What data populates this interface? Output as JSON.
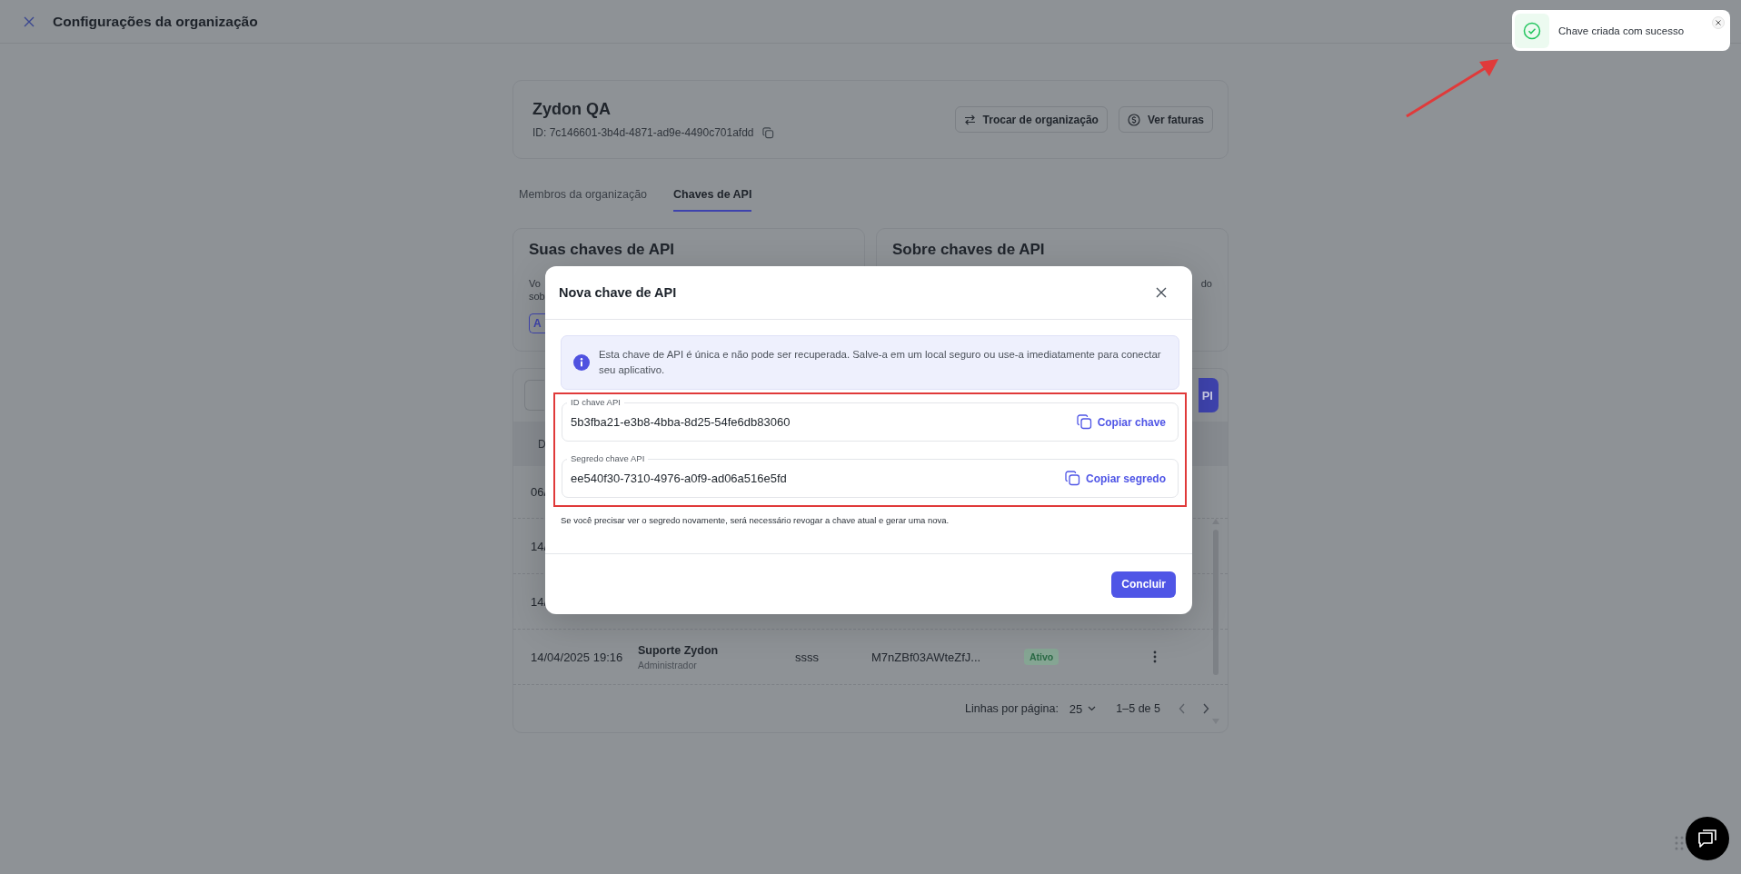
{
  "header": {
    "title": "Configurações da organização"
  },
  "organization": {
    "name": "Zydon QA",
    "id": "ID: 7c146601-3b4d-4871-ad9e-4490c701afdd",
    "actions": [
      {
        "label": "Trocar de organização",
        "kind": "switch"
      },
      {
        "label": "Ver faturas",
        "kind": "invoice"
      }
    ]
  },
  "tabs": [
    {
      "label": "Membros da organização",
      "selected": false
    },
    {
      "label": "Chaves de API",
      "selected": true
    }
  ],
  "cards": [
    {
      "title": "Suas chaves de API",
      "text_lines": [
        "Vo",
        "sob"
      ],
      "button": "A"
    },
    {
      "title": "Sobre chaves de API",
      "text_lines": [
        "do"
      ]
    }
  ],
  "table": {
    "action_button": "PI",
    "columns": [
      "D"
    ],
    "rows": [
      {
        "date": "06/"
      },
      {
        "date": "14/"
      },
      {
        "date": "14/"
      },
      {
        "date": "14/04/2025 19:16",
        "user": "Suporte Zydon",
        "role": "Administrador",
        "name": "ssss",
        "key": "M7nZBf03AWteZfJ...",
        "status": "Ativo"
      }
    ],
    "pagination": {
      "rows_label": "Linhas por página:",
      "rows_value": "25",
      "range": "1–5 de 5"
    }
  },
  "modal": {
    "title": "Nova chave de API",
    "info": "Esta chave de API é única e não pode ser recuperada. Salve-a em um local seguro ou use-a imediatamente para conectar seu aplicativo.",
    "fields": [
      {
        "label": "ID chave API",
        "value": "5b3fba21-e3b8-4bba-8d25-54fe6db83060",
        "action": "Copiar chave"
      },
      {
        "label": "Segredo chave API",
        "value": "ee540f30-7310-4976-a0f9-ad06a516e5fd",
        "action": "Copiar segredo"
      }
    ],
    "note": "Se você precisar ver o segredo novamente, será necessário revogar a chave atual e gerar uma nova.",
    "button": "Concluir"
  },
  "toast": {
    "message": "Chave criada com sucesso"
  }
}
